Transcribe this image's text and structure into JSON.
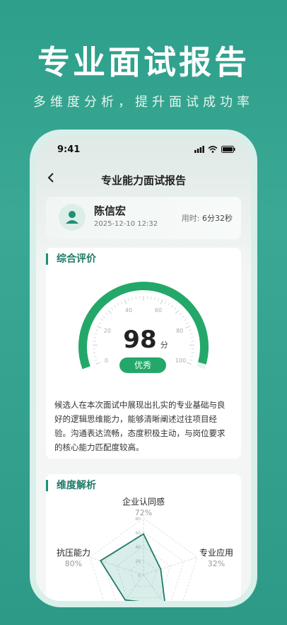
{
  "promo": {
    "title": "专业面试报告",
    "subtitle": "多维度分析，提升面试成功率"
  },
  "status_bar": {
    "time": "9:41"
  },
  "nav": {
    "back_icon": "chevron-left-icon",
    "title": "专业能力面试报告"
  },
  "candidate": {
    "name": "陈信宏",
    "datetime": "2025-12-10 12:32",
    "duration_label": "用时:",
    "duration_value": "6分32秒"
  },
  "evaluation": {
    "section_title": "综合评价",
    "score": 98,
    "score_display": "98",
    "unit": "分",
    "level": "优秀",
    "gauge_ticks": [
      "0",
      "20",
      "40",
      "60",
      "80",
      "100"
    ],
    "comment": "候选人在本次面试中展现出扎实的专业基础与良好的逻辑思维能力，能够清晰阐述过往项目经验。沟通表达流畅，态度积极主动，与岗位要求的核心能力匹配度较高。"
  },
  "dimensions": {
    "section_title": "维度解析",
    "axes": [
      {
        "name": "企业认同感",
        "value_label": "72%",
        "value": 72
      },
      {
        "name": "专业应用",
        "value_label": "32%",
        "value": 32
      },
      {
        "name": "抗压能力",
        "value_label": "80%",
        "value": 80
      }
    ],
    "scale_ticks": [
      "80",
      "60",
      "40",
      "20",
      "0"
    ]
  },
  "colors": {
    "brand": "#2d9f8a",
    "gauge_green": "#23a86a",
    "section_title": "#1f7a68"
  }
}
